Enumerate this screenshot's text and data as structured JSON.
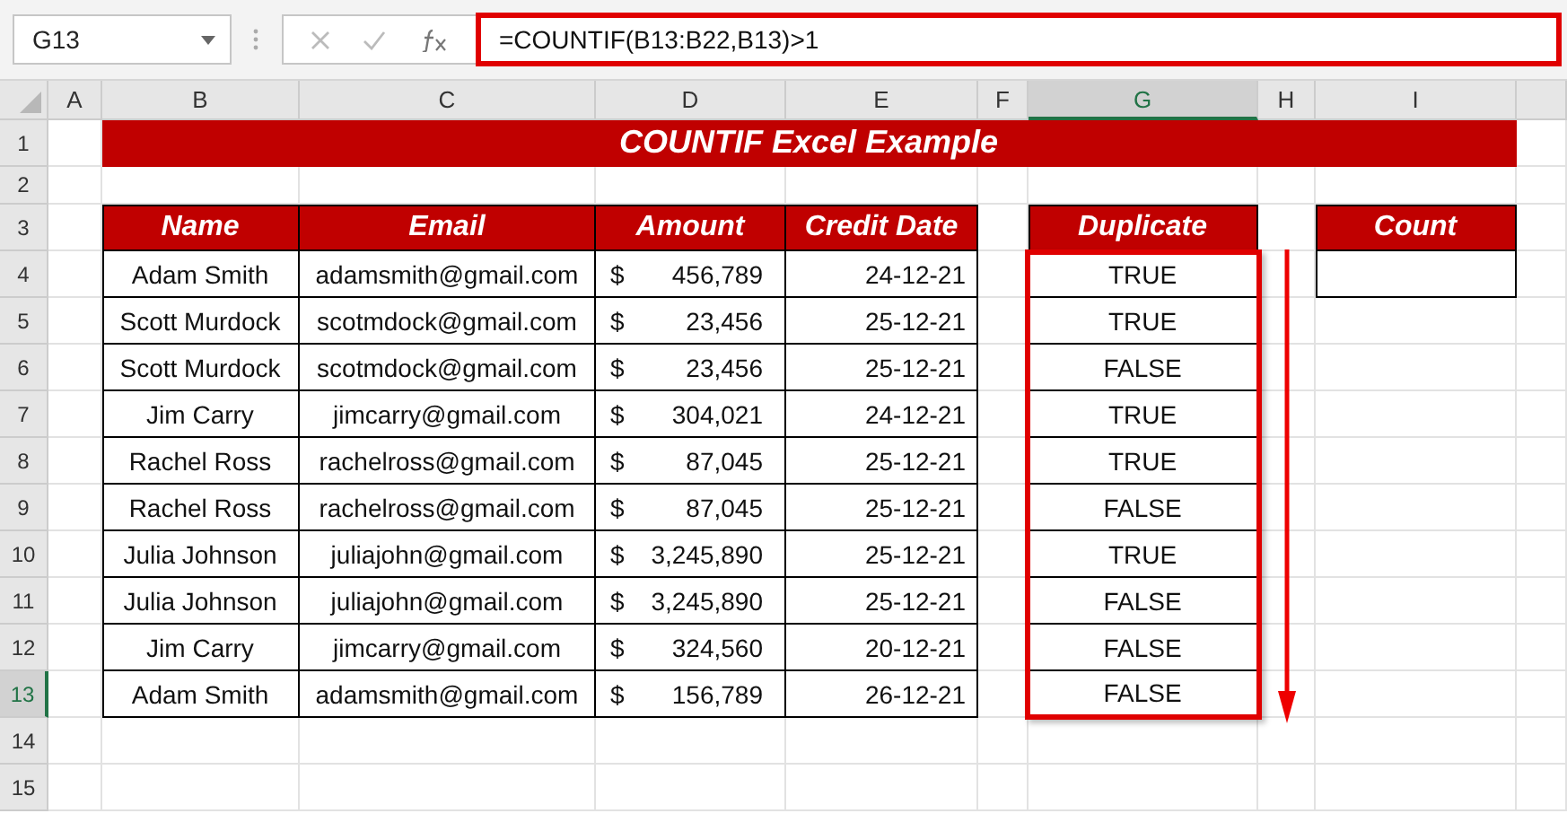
{
  "name_box": "G13",
  "formula": "=COUNTIF(B13:B22,B13)>1",
  "columns": [
    {
      "label": "A",
      "selected": false
    },
    {
      "label": "B",
      "selected": false
    },
    {
      "label": "C",
      "selected": false
    },
    {
      "label": "D",
      "selected": false
    },
    {
      "label": "E",
      "selected": false
    },
    {
      "label": "F",
      "selected": false
    },
    {
      "label": "G",
      "selected": true
    },
    {
      "label": "H",
      "selected": false
    },
    {
      "label": "I",
      "selected": false
    }
  ],
  "row_numbers": [
    {
      "label": "1",
      "selected": false
    },
    {
      "label": "2",
      "selected": false
    },
    {
      "label": "3",
      "selected": false
    },
    {
      "label": "4",
      "selected": false
    },
    {
      "label": "5",
      "selected": false
    },
    {
      "label": "6",
      "selected": false
    },
    {
      "label": "7",
      "selected": false
    },
    {
      "label": "8",
      "selected": false
    },
    {
      "label": "9",
      "selected": false
    },
    {
      "label": "10",
      "selected": false
    },
    {
      "label": "11",
      "selected": false
    },
    {
      "label": "12",
      "selected": false
    },
    {
      "label": "13",
      "selected": true
    },
    {
      "label": "14",
      "selected": false
    },
    {
      "label": "15",
      "selected": false
    }
  ],
  "title": "COUNTIF Excel Example",
  "table": {
    "columns": [
      "Name",
      "Email",
      "Amount",
      "Credit Date"
    ],
    "rows": [
      {
        "name": "Adam Smith",
        "email": "adamsmith@gmail.com",
        "currency": "$",
        "amount": "456,789",
        "credit_date": "24-12-21",
        "duplicate": "TRUE"
      },
      {
        "name": "Scott Murdock",
        "email": "scotmdock@gmail.com",
        "currency": "$",
        "amount": "23,456",
        "credit_date": "25-12-21",
        "duplicate": "TRUE"
      },
      {
        "name": "Scott Murdock",
        "email": "scotmdock@gmail.com",
        "currency": "$",
        "amount": "23,456",
        "credit_date": "25-12-21",
        "duplicate": "FALSE"
      },
      {
        "name": "Jim Carry",
        "email": "jimcarry@gmail.com",
        "currency": "$",
        "amount": "304,021",
        "credit_date": "24-12-21",
        "duplicate": "TRUE"
      },
      {
        "name": "Rachel Ross",
        "email": "rachelross@gmail.com",
        "currency": "$",
        "amount": "87,045",
        "credit_date": "25-12-21",
        "duplicate": "TRUE"
      },
      {
        "name": "Rachel Ross",
        "email": "rachelross@gmail.com",
        "currency": "$",
        "amount": "87,045",
        "credit_date": "25-12-21",
        "duplicate": "FALSE"
      },
      {
        "name": "Julia Johnson",
        "email": "juliajohn@gmail.com",
        "currency": "$",
        "amount": "3,245,890",
        "credit_date": "25-12-21",
        "duplicate": "TRUE"
      },
      {
        "name": "Julia Johnson",
        "email": "juliajohn@gmail.com",
        "currency": "$",
        "amount": "3,245,890",
        "credit_date": "25-12-21",
        "duplicate": "FALSE"
      },
      {
        "name": "Jim Carry",
        "email": "jimcarry@gmail.com",
        "currency": "$",
        "amount": "324,560",
        "credit_date": "20-12-21",
        "duplicate": "FALSE"
      },
      {
        "name": "Adam Smith",
        "email": "adamsmith@gmail.com",
        "currency": "$",
        "amount": "156,789",
        "credit_date": "26-12-21",
        "duplicate": "FALSE"
      }
    ]
  },
  "duplicate_header": "Duplicate",
  "count_header": "Count"
}
